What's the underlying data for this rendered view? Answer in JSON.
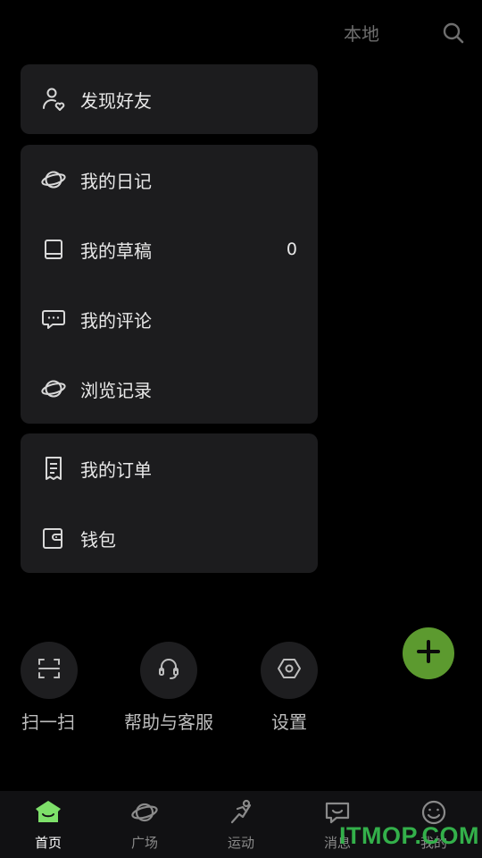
{
  "header": {
    "local_label": "本地"
  },
  "card_friends": {
    "items": [
      {
        "label": "发现好友",
        "icon": "person-heart-icon"
      }
    ]
  },
  "card_mine": {
    "items": [
      {
        "label": "我的日记",
        "icon": "planet-icon"
      },
      {
        "label": "我的草稿",
        "icon": "book-icon",
        "count": "0"
      },
      {
        "label": "我的评论",
        "icon": "chat-bubble-icon"
      },
      {
        "label": "浏览记录",
        "icon": "planet-icon"
      }
    ]
  },
  "card_orders": {
    "items": [
      {
        "label": "我的订单",
        "icon": "receipt-icon"
      },
      {
        "label": "钱包",
        "icon": "wallet-icon"
      }
    ]
  },
  "quick_actions": [
    {
      "label": "扫一扫",
      "icon": "scan-icon"
    },
    {
      "label": "帮助与客服",
      "icon": "headset-icon"
    },
    {
      "label": "设置",
      "icon": "settings-hexagon-icon"
    }
  ],
  "tabs": [
    {
      "label": "首页",
      "icon": "home-face-icon",
      "active": true
    },
    {
      "label": "广场",
      "icon": "planet-icon"
    },
    {
      "label": "运动",
      "icon": "sport-icon"
    },
    {
      "label": "消息",
      "icon": "message-icon"
    },
    {
      "label": "我的",
      "icon": "smile-icon"
    }
  ],
  "watermark": "ITMOP.COM",
  "colors": {
    "background": "#000000",
    "card": "#1c1c1e",
    "accent": "#5c9a2f",
    "tabbar": "#111113",
    "active_icon": "#7ee06a"
  }
}
